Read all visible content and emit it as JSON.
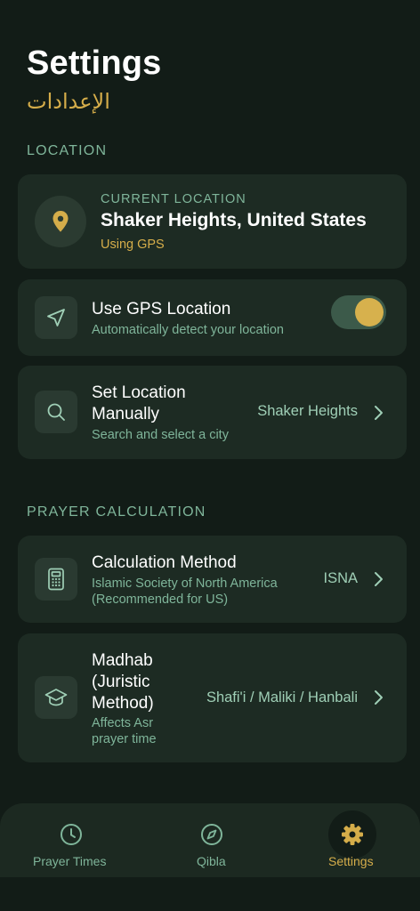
{
  "header": {
    "title": "Settings",
    "subtitle": "الإعدادات"
  },
  "location_section": {
    "label": "LOCATION",
    "current": {
      "label": "CURRENT LOCATION",
      "name": "Shaker Heights, United States",
      "source": "Using GPS",
      "icon": "map-pin-icon"
    },
    "gps": {
      "title": "Use GPS Location",
      "subtitle": "Automatically detect your location",
      "enabled": true,
      "icon": "navigation-arrow-icon"
    },
    "manual": {
      "title_line1": "Set Location",
      "title_line2": "Manually",
      "subtitle": "Search and select a city",
      "value": "Shaker Heights",
      "icon": "search-icon"
    }
  },
  "prayer_section": {
    "label": "PRAYER CALCULATION",
    "method": {
      "title": "Calculation Method",
      "subtitle_line1": "Islamic Society of North America",
      "subtitle_line2": "(Recommended for US)",
      "value": "ISNA",
      "icon": "calculator-icon"
    },
    "madhab": {
      "title_line1": "Madhab",
      "title_line2": "(Juristic",
      "title_line3": "Method)",
      "subtitle_line1": "Affects Asr",
      "subtitle_line2": "prayer time",
      "value": "Shafi'i / Maliki / Hanbali",
      "icon": "graduation-cap-icon"
    }
  },
  "tabs": [
    {
      "label": "Prayer Times",
      "icon": "clock-icon",
      "active": false
    },
    {
      "label": "Qibla",
      "icon": "compass-icon",
      "active": false
    },
    {
      "label": "Settings",
      "icon": "gear-icon",
      "active": true
    }
  ],
  "colors": {
    "background": "#121c17",
    "card": "#1d2b23",
    "accent_gold": "#d5ad4a",
    "muted_green": "#7fb59a"
  }
}
